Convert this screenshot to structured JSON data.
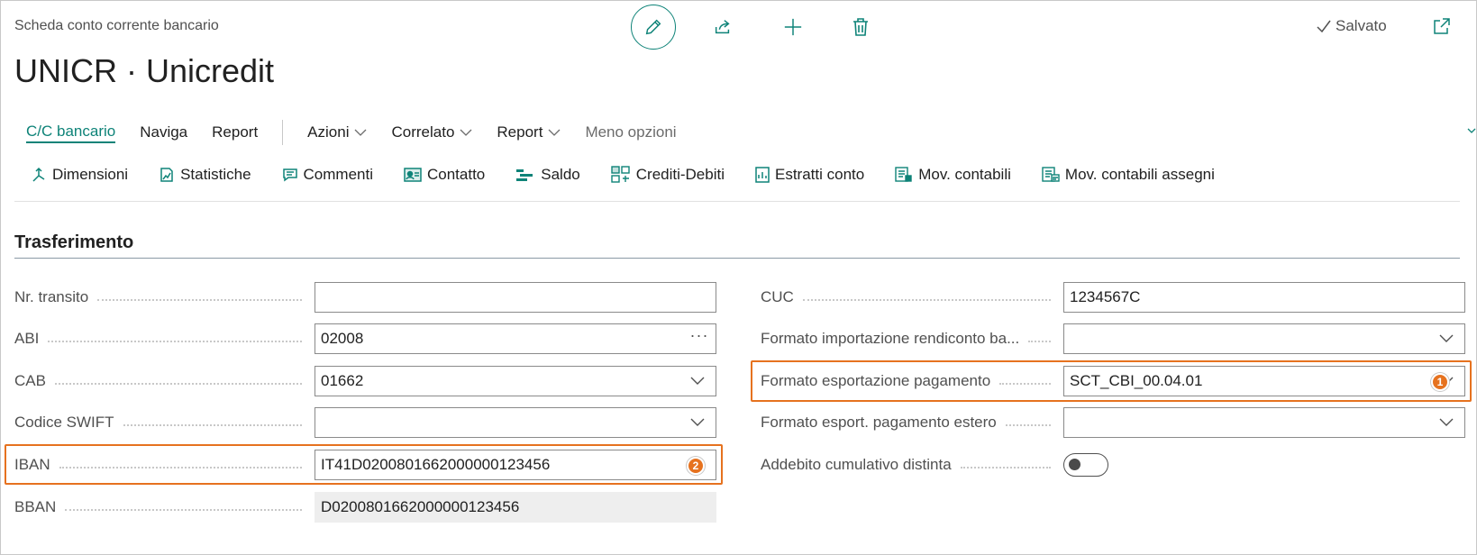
{
  "header": {
    "caption": "Scheda conto corrente bancario",
    "title": "UNICR · Unicredit",
    "saved_label": "Salvato"
  },
  "nav": {
    "items": [
      {
        "label": "C/C bancario",
        "active": true
      },
      {
        "label": "Naviga"
      },
      {
        "label": "Report"
      }
    ],
    "menus": [
      {
        "label": "Azioni"
      },
      {
        "label": "Correlato"
      },
      {
        "label": "Report"
      }
    ],
    "less_options": "Meno opzioni"
  },
  "actions": [
    {
      "label": "Dimensioni",
      "icon": "dimensions-icon"
    },
    {
      "label": "Statistiche",
      "icon": "statistics-icon"
    },
    {
      "label": "Commenti",
      "icon": "comments-icon"
    },
    {
      "label": "Contatto",
      "icon": "contact-icon"
    },
    {
      "label": "Saldo",
      "icon": "balance-icon"
    },
    {
      "label": "Crediti-Debiti",
      "icon": "credits-debits-icon"
    },
    {
      "label": "Estratti conto",
      "icon": "statements-icon"
    },
    {
      "label": "Mov. contabili",
      "icon": "ledger-entries-icon"
    },
    {
      "label": "Mov. contabili assegni",
      "icon": "check-ledger-entries-icon"
    }
  ],
  "section": {
    "title": "Trasferimento"
  },
  "left_fields": [
    {
      "label": "Nr. transito",
      "value": ""
    },
    {
      "label": "ABI",
      "value": "02008"
    },
    {
      "label": "CAB",
      "value": "01662"
    },
    {
      "label": "Codice SWIFT",
      "value": ""
    },
    {
      "label": "IBAN",
      "value": "IT41D0200801662000000123456",
      "badge": "2"
    },
    {
      "label": "BBAN",
      "value": "D0200801662000000123456"
    }
  ],
  "right_fields": [
    {
      "label": "CUC",
      "value": "1234567C"
    },
    {
      "label": "Formato importazione rendiconto ba...",
      "value": ""
    },
    {
      "label": "Formato esportazione pagamento",
      "value": "SCT_CBI_00.04.01",
      "badge": "1"
    },
    {
      "label": "Formato esport. pagamento estero",
      "value": ""
    },
    {
      "label": "Addebito cumulativo distinta",
      "value_bool": false
    }
  ],
  "colors": {
    "accent": "#0e8378",
    "highlight": "#e6721f"
  }
}
